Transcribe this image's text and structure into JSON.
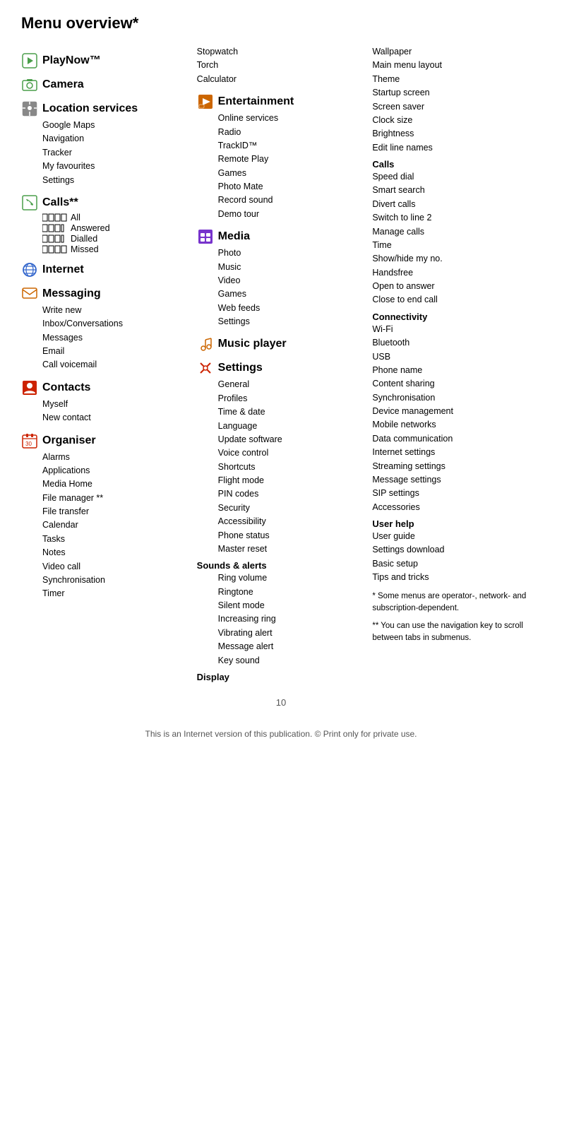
{
  "page": {
    "title": "Menu overview*",
    "page_number": "10",
    "footer": "This is an Internet version of this publication. © Print only for private use."
  },
  "col1": {
    "sections": [
      {
        "id": "playnow",
        "icon": "playnow-icon",
        "title": "PlayNow™",
        "items": []
      },
      {
        "id": "camera",
        "icon": "camera-icon",
        "title": "Camera",
        "items": []
      },
      {
        "id": "location",
        "icon": "location-icon",
        "title": "Location services",
        "items": [
          "Google Maps",
          "Navigation",
          "Tracker",
          "My favourites",
          "Settings"
        ]
      },
      {
        "id": "calls",
        "icon": "calls-icon",
        "title": "Calls**",
        "calls_types": [
          {
            "label": "All",
            "bars": 4,
            "partial": 4
          },
          {
            "label": "Answered",
            "bars": 4,
            "partial": 3
          },
          {
            "label": "Dialled",
            "bars": 4,
            "partial": 3
          },
          {
            "label": "Missed",
            "bars": 4,
            "partial": 4
          }
        ]
      },
      {
        "id": "internet",
        "icon": "internet-icon",
        "title": "Internet",
        "items": []
      },
      {
        "id": "messaging",
        "icon": "messaging-icon",
        "title": "Messaging",
        "items": [
          "Write new",
          "Inbox/Conversations",
          "Messages",
          "Email",
          "Call voicemail"
        ]
      },
      {
        "id": "contacts",
        "icon": "contacts-icon",
        "title": "Contacts",
        "items": [
          "Myself",
          "New contact"
        ]
      },
      {
        "id": "organiser",
        "icon": "organiser-icon",
        "title": "Organiser",
        "items": [
          "Alarms",
          "Applications",
          "Media Home",
          "File manager **",
          "File transfer",
          "Calendar",
          "Tasks",
          "Notes",
          "Video call",
          "Synchronisation",
          "Timer"
        ]
      }
    ]
  },
  "col2": {
    "top_items": [
      "Stopwatch",
      "Torch",
      "Calculator"
    ],
    "sections": [
      {
        "id": "entertainment",
        "icon": "entertainment-icon",
        "title": "Entertainment",
        "items": [
          "Online services",
          "Radio",
          "TrackID™",
          "Remote Play",
          "Games",
          "Photo Mate",
          "Record sound",
          "Demo tour"
        ]
      },
      {
        "id": "media",
        "icon": "media-icon",
        "title": "Media",
        "items": [
          "Photo",
          "Music",
          "Video",
          "Games",
          "Web feeds",
          "Settings"
        ]
      },
      {
        "id": "musicplayer",
        "icon": "musicplayer-icon",
        "title": "Music player",
        "items": []
      },
      {
        "id": "settings",
        "icon": "settings-icon",
        "title": "Settings",
        "items": [
          "General",
          "Profiles",
          "Time & date",
          "Language",
          "Update software",
          "Voice control",
          "Shortcuts",
          "Flight mode",
          "PIN codes",
          "Security",
          "Accessibility",
          "Phone status",
          "Master reset"
        ]
      },
      {
        "id": "sounds",
        "sub_header": "Sounds & alerts",
        "items": [
          "Ring volume",
          "Ringtone",
          "Silent mode",
          "Increasing ring",
          "Vibrating alert",
          "Message alert",
          "Key sound"
        ]
      },
      {
        "id": "display",
        "sub_header": "Display",
        "items": []
      }
    ]
  },
  "col3": {
    "top_items": [
      "Wallpaper",
      "Main menu layout",
      "Theme",
      "Startup screen",
      "Screen saver",
      "Clock size",
      "Brightness",
      "Edit line names"
    ],
    "sections": [
      {
        "id": "calls_sub",
        "sub_header": "Calls",
        "items": [
          "Speed dial",
          "Smart search",
          "Divert calls",
          "Switch to line 2",
          "Manage calls",
          "Time",
          "Show/hide my no.",
          "Handsfree",
          "Open to answer",
          "Close to end call"
        ]
      },
      {
        "id": "connectivity",
        "sub_header": "Connectivity",
        "items": [
          "Wi-Fi",
          "Bluetooth",
          "USB",
          "Phone name",
          "Content sharing",
          "Synchronisation",
          "Device management",
          "Mobile networks",
          "Data communication",
          "Internet settings",
          "Streaming settings",
          "Message settings",
          "SIP settings",
          "Accessories"
        ]
      },
      {
        "id": "userhelp",
        "sub_header": "User help",
        "items": [
          "User guide",
          "Settings download",
          "Basic setup",
          "Tips and tricks"
        ]
      }
    ],
    "notes": [
      "* Some menus are operator-, network- and subscription-dependent.",
      "** You can use the navigation key to scroll between tabs in submenus."
    ]
  }
}
